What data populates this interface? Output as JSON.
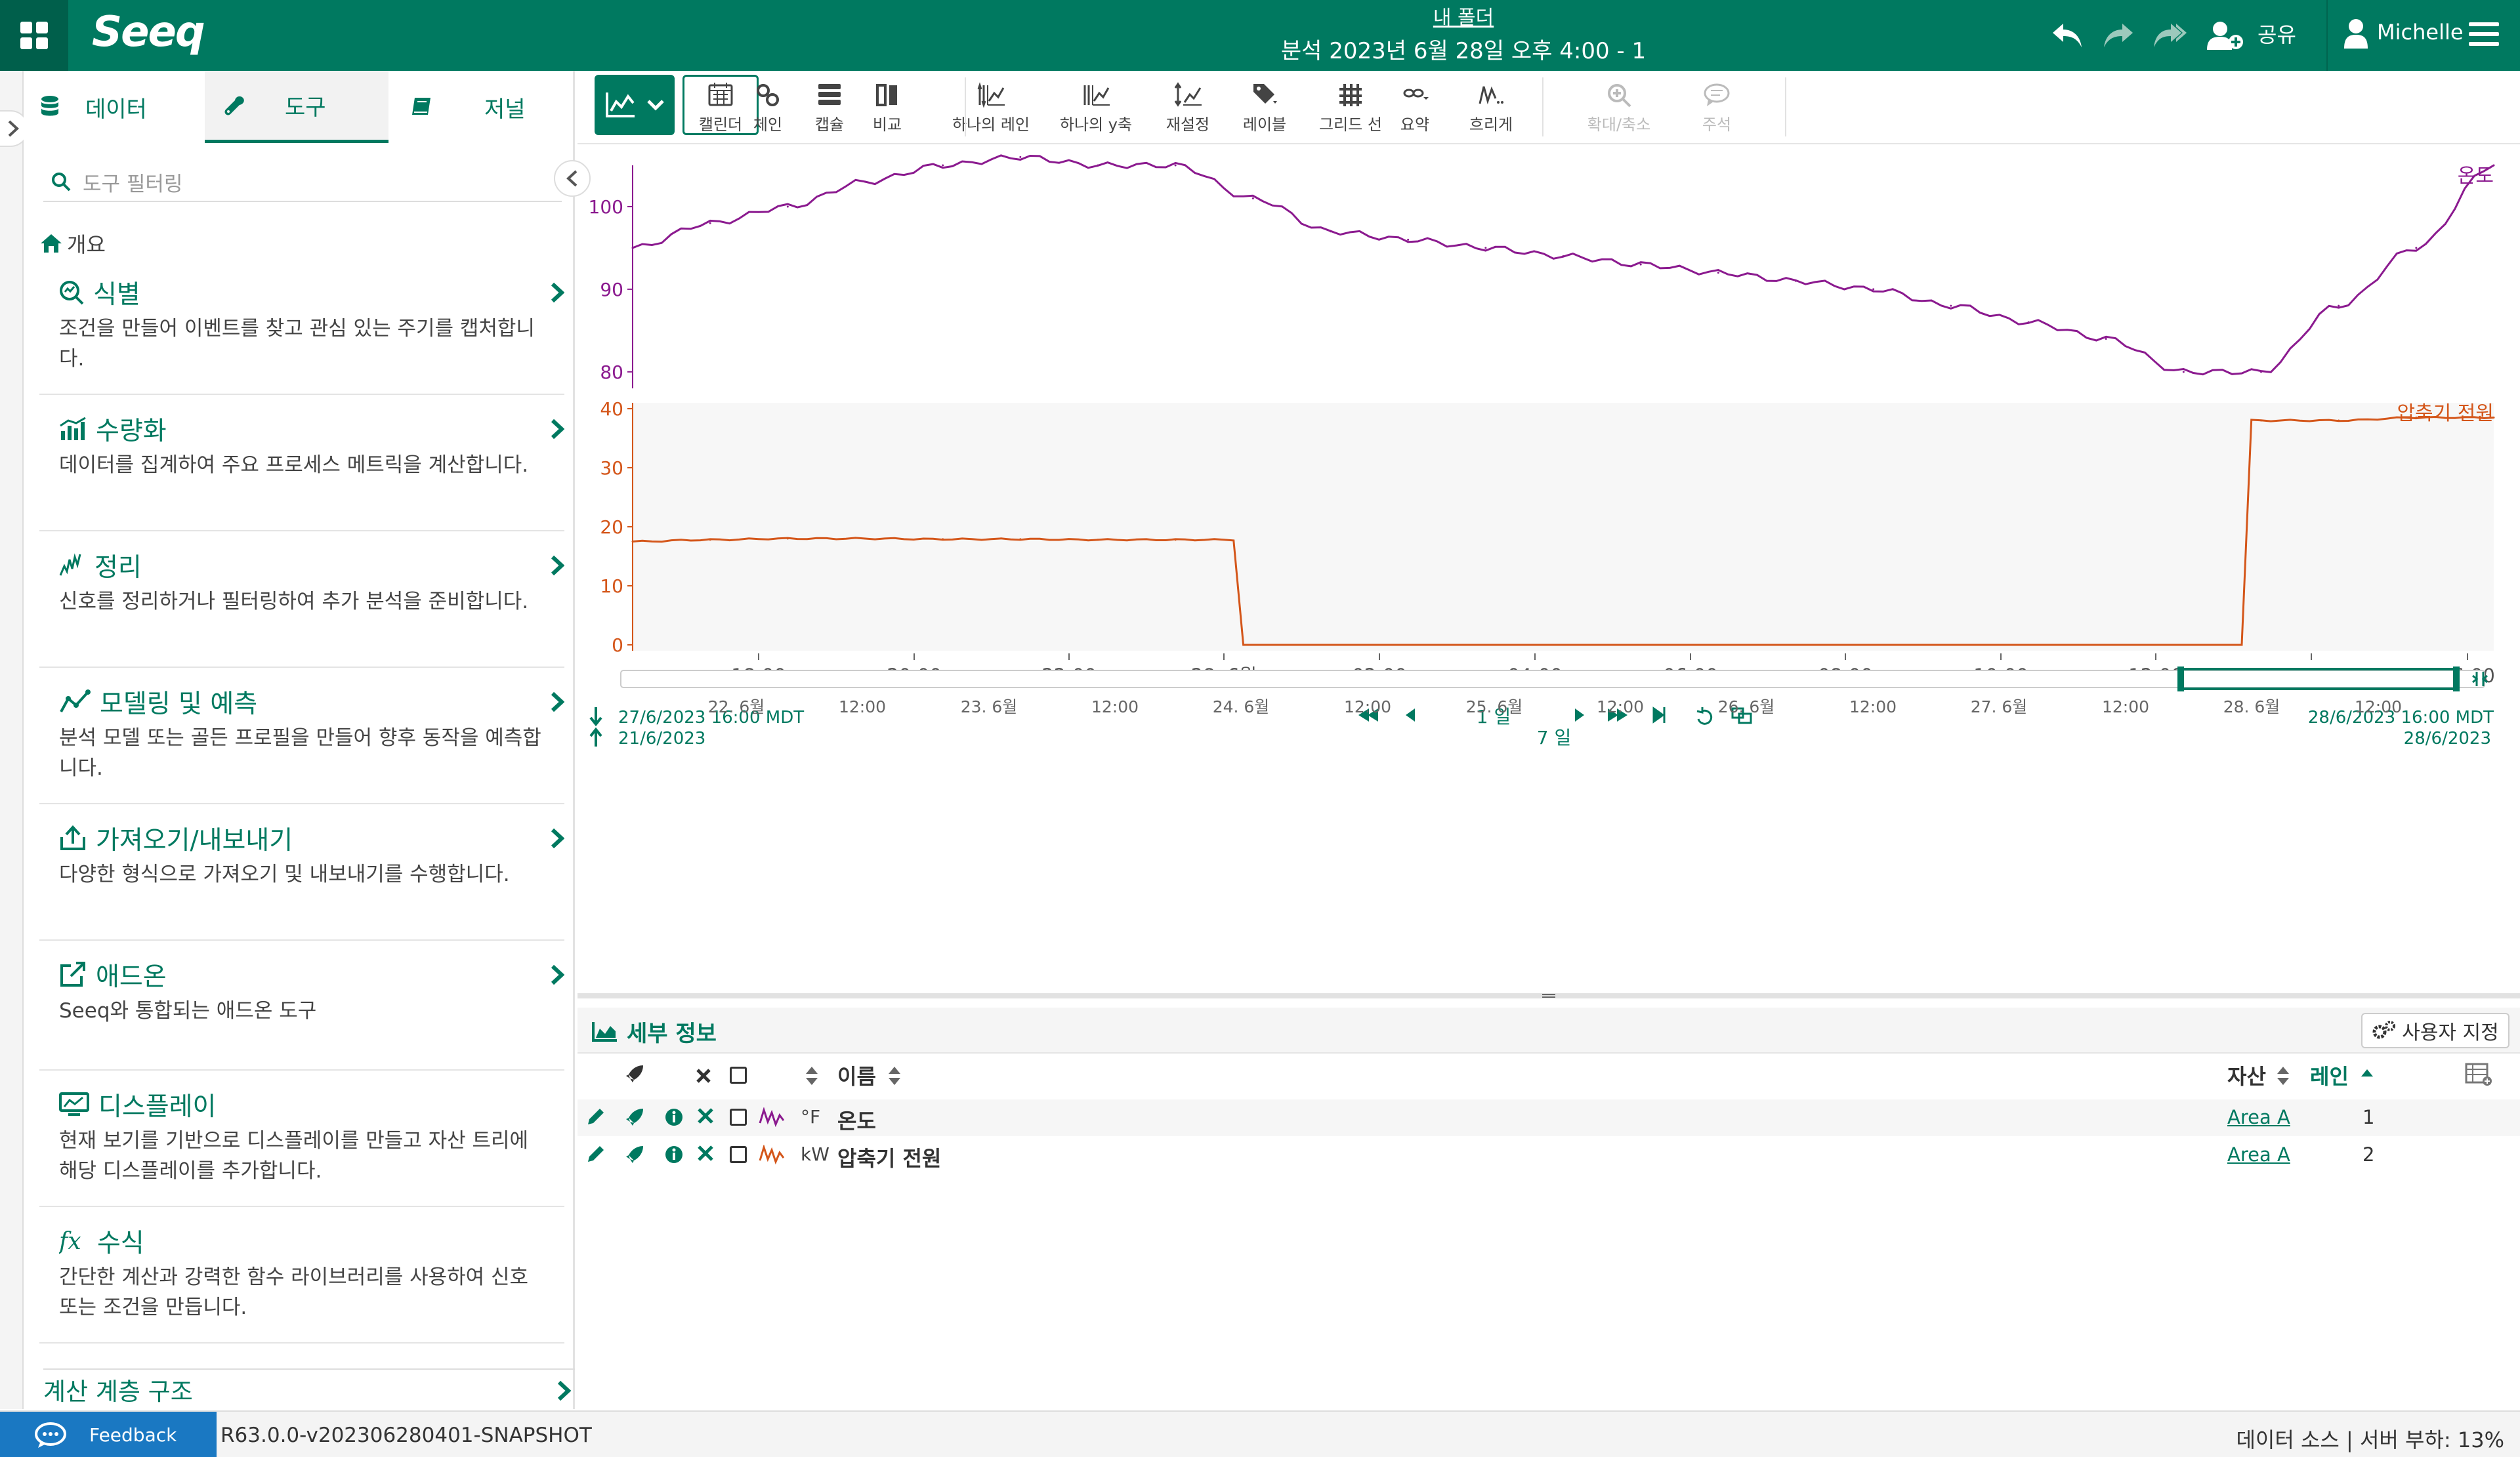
{
  "header": {
    "app_name": "Seeq",
    "folder": "내 폴더",
    "title": "분석 2023년 6월 28일 오후 4:00 - 1",
    "share_label": "공유",
    "user_name": "Michelle"
  },
  "left_panel": {
    "tabs": [
      {
        "label": "데이터",
        "icon": "database-icon"
      },
      {
        "label": "도구",
        "icon": "wrench-icon",
        "active": true
      },
      {
        "label": "저널",
        "icon": "book-icon"
      }
    ],
    "filter_placeholder": "도구 필터링",
    "overview_label": "개요",
    "tools": [
      {
        "title": "식별",
        "desc": "조건을 만들어 이벤트를 찾고 관심 있는 주기를 캡처합니다.",
        "icon": "identify-icon"
      },
      {
        "title": "수량화",
        "desc": "데이터를 집계하여 주요 프로세스 메트릭을 계산합니다.",
        "icon": "quantify-icon"
      },
      {
        "title": "정리",
        "desc": "신호를 정리하거나 필터링하여 추가 분석을 준비합니다.",
        "icon": "cleanse-icon"
      },
      {
        "title": "모델링 및 예측",
        "desc": "분석 모델 또는 골든 프로필을 만들어 향후 동작을 예측합니다.",
        "icon": "model-icon"
      },
      {
        "title": "가져오기/내보내기",
        "desc": "다양한 형식으로 가져오기 및 내보내기를 수행합니다.",
        "icon": "import-export-icon"
      },
      {
        "title": "애드온",
        "desc": "Seeq와 통합되는 애드온 도구",
        "icon": "addon-icon"
      },
      {
        "title": "디스플레이",
        "desc": "현재 보기를 기반으로 디스플레이를 만들고 자산 트리에 해당 디스플레이를 추가합니다.",
        "icon": "display-icon"
      },
      {
        "title": "수식",
        "desc": "간단한 계산과 강력한 함수 라이브러리를 사용하여 신호 또는 조건을 만듭니다.",
        "icon": "formula-icon"
      }
    ],
    "calc_hierarchy": "계산 계층 구조"
  },
  "toolbar": {
    "buttons": [
      {
        "label": "캘린더",
        "icon": "calendar-icon"
      },
      {
        "label": "체인",
        "icon": "chain-icon"
      },
      {
        "label": "캡슐",
        "icon": "capsule-icon"
      },
      {
        "label": "비교",
        "icon": "compare-icon"
      },
      {
        "label": "하나의 레인",
        "icon": "one-lane-icon"
      },
      {
        "label": "하나의 y축",
        "icon": "one-y-axis-icon"
      },
      {
        "label": "재설정",
        "icon": "reset-icon"
      },
      {
        "label": "레이블",
        "icon": "label-icon"
      },
      {
        "label": "그리드 선",
        "icon": "grid-icon"
      },
      {
        "label": "요약",
        "icon": "summary-icon"
      },
      {
        "label": "흐리게",
        "icon": "dim-icon"
      },
      {
        "label": "확대/축소",
        "icon": "zoom-icon",
        "disabled": true
      },
      {
        "label": "주석",
        "icon": "annotation-icon",
        "disabled": true
      }
    ]
  },
  "trend": {
    "display_range": {
      "start": "27/6/2023 16:00  MDT",
      "end": "28/6/2023 16:00  MDT",
      "duration": "1 일"
    },
    "x_ticks": [
      "18:00",
      "20:00",
      "22:00",
      "28. 6월",
      "02:00",
      "04:00",
      "06:00",
      "08:00",
      "10:00",
      "12:00",
      "14:00",
      "16:00"
    ],
    "investigate_range": {
      "start": "21/6/2023",
      "end": "28/6/2023",
      "duration": "7 일"
    },
    "nav_ticks": [
      "22. 6월",
      "12:00",
      "23. 6월",
      "12:00",
      "24. 6월",
      "12:00",
      "25. 6월",
      "12:00",
      "26. 6월",
      "12:00",
      "27. 6월",
      "12:00",
      "28. 6월",
      "12:00"
    ],
    "colors": {
      "temperature": "#8b1a8f",
      "power": "#d4561a",
      "brand": "#007960"
    }
  },
  "chart_data": {
    "type": "line",
    "x": [
      "16:00",
      "17:00",
      "18:00",
      "19:00",
      "20:00",
      "21:00",
      "22:00",
      "23:00",
      "00:00",
      "01:00",
      "02:00",
      "03:00",
      "04:00",
      "05:00",
      "06:00",
      "07:00",
      "08:00",
      "09:00",
      "10:00",
      "11:00",
      "12:00",
      "13:00",
      "14:00",
      "15:00",
      "16:00"
    ],
    "lanes": [
      {
        "name": "온도",
        "ylim": [
          78,
          105
        ],
        "yticks": [
          80,
          90,
          100
        ],
        "values": [
          95,
          98,
          100,
          103,
          105,
          106,
          105,
          105,
          101,
          97,
          96,
          95,
          94,
          93,
          92,
          91,
          90,
          88,
          86,
          84,
          80,
          80,
          88,
          95,
          105
        ]
      },
      {
        "name": "압축기 전원",
        "ylim": [
          -1,
          41
        ],
        "yticks": [
          0,
          10,
          20,
          30,
          40
        ],
        "values": [
          17.5,
          17.8,
          18,
          18,
          17.9,
          17.9,
          17.8,
          17.8,
          0,
          0,
          0,
          0,
          0,
          0,
          0,
          0,
          0,
          0,
          0,
          0,
          0,
          38,
          38,
          38.5,
          38.5
        ]
      }
    ]
  },
  "details": {
    "title": "세부 정보",
    "customize_label": "사용자 지정",
    "columns": {
      "name": "이름",
      "asset": "자산",
      "lane": "레인"
    },
    "rows": [
      {
        "unit": "°F",
        "name": "온도",
        "asset": "Area A",
        "lane": "1",
        "color": "#8b1a8f"
      },
      {
        "unit": "kW",
        "name": "압축기 전원",
        "asset": "Area A",
        "lane": "2",
        "color": "#d4561a"
      }
    ]
  },
  "footer": {
    "feedback": "Feedback",
    "version": "R63.0.0-v202306280401-SNAPSHOT",
    "server_load": "데이터 소스 | 서버 부하: 13%"
  }
}
